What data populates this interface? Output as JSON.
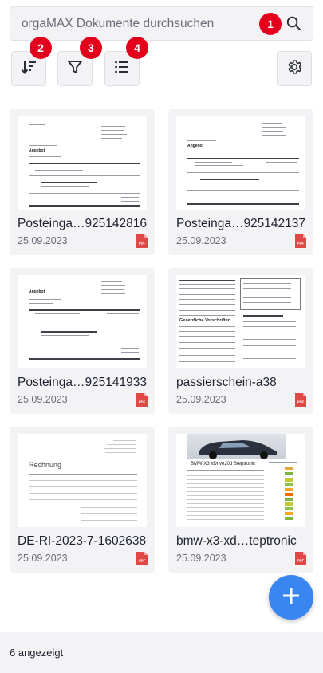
{
  "search": {
    "placeholder": "orgaMAX Dokumente durchsuchen"
  },
  "badges": [
    "1",
    "2",
    "3",
    "4"
  ],
  "toolbar": {
    "sort_icon": "sort-icon",
    "filter_icon": "filter-icon",
    "list_icon": "list-view-icon",
    "settings_icon": "gear-icon"
  },
  "documents": [
    {
      "title": "Posteinga…925142816",
      "date": "25.09.2023",
      "type": "pdf"
    },
    {
      "title": "Posteinga…925142137",
      "date": "25.09.2023",
      "type": "pdf"
    },
    {
      "title": "Posteinga…925141933",
      "date": "25.09.2023",
      "type": "pdf"
    },
    {
      "title": "passierschein-a38",
      "date": "25.09.2023",
      "type": "pdf"
    },
    {
      "title": "DE-RI-2023-7-1602638",
      "date": "25.09.2023",
      "type": "pdf"
    },
    {
      "title": "bmw-x3-xd…teptronic",
      "date": "25.09.2023",
      "type": "pdf"
    }
  ],
  "thumbnails": {
    "doc1_heading": "Angebot",
    "doc2_heading": "Angebot",
    "doc3_heading": "Angebot",
    "doc4_heading": "Gesetzliche Vorschriften",
    "doc5_heading": "Rechnung",
    "doc6_heading": "BMW X3 xDrive20d Steptronic"
  },
  "fab": {
    "icon": "plus-icon"
  },
  "footer": {
    "count_text": "6 angezeigt"
  },
  "colors": {
    "badge": "#e4001c",
    "fab": "#3a86f0",
    "pdf": "#e04848"
  }
}
